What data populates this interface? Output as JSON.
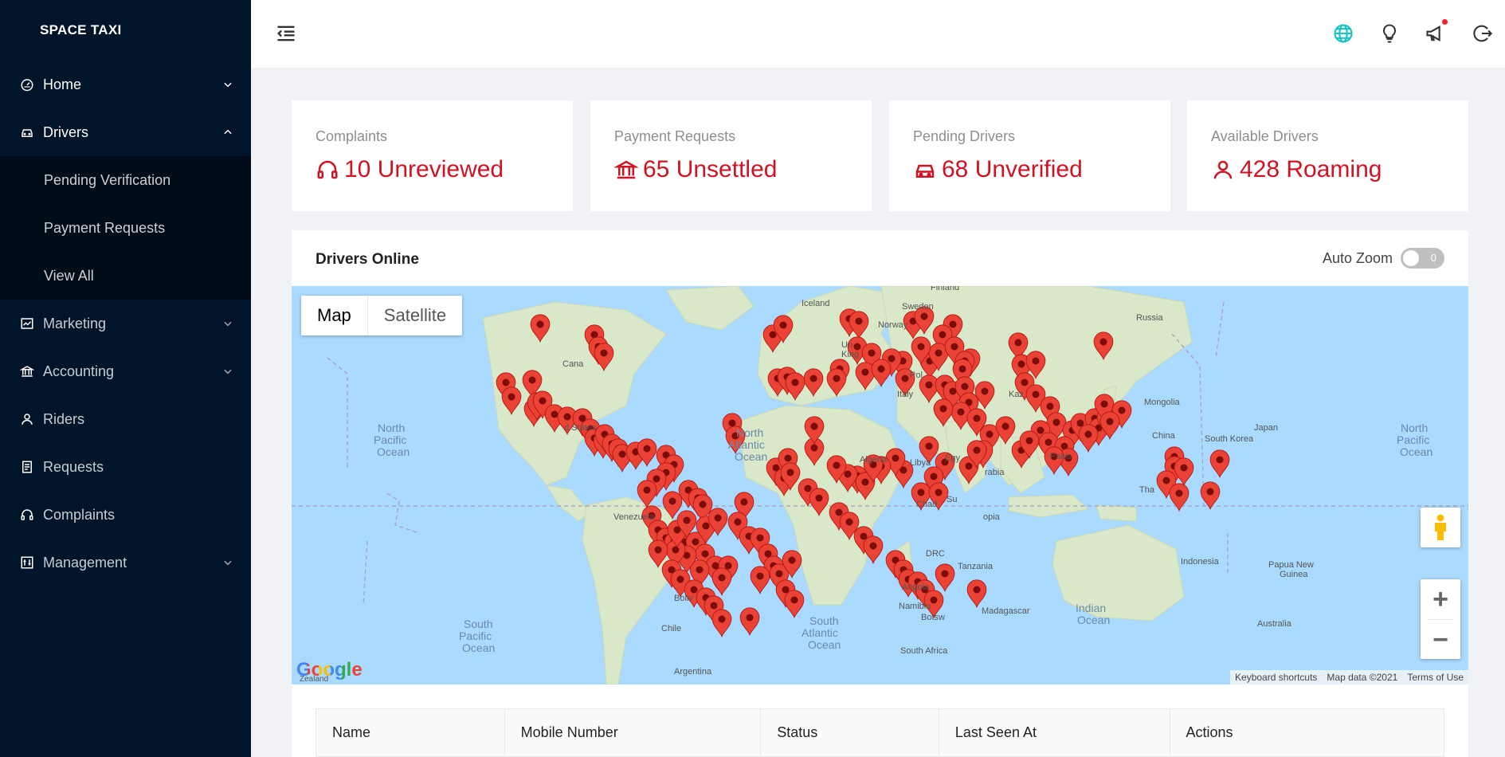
{
  "brand": "SPACE TAXI",
  "sidebar": {
    "items": [
      {
        "label": "Home",
        "icon": "dashboard-icon"
      },
      {
        "label": "Drivers",
        "icon": "car-icon"
      },
      {
        "label": "Marketing",
        "icon": "chart-icon"
      },
      {
        "label": "Accounting",
        "icon": "bank-icon"
      },
      {
        "label": "Riders",
        "icon": "user-icon"
      },
      {
        "label": "Requests",
        "icon": "list-icon"
      },
      {
        "label": "Complaints",
        "icon": "headset-icon"
      },
      {
        "label": "Management",
        "icon": "control-icon"
      }
    ],
    "drivers_submenu": [
      "Pending Verification",
      "Payment Requests",
      "View All"
    ]
  },
  "header": {
    "icons": [
      "globe-icon",
      "bulb-icon",
      "megaphone-icon",
      "logout-icon"
    ],
    "accent": "#13c2c2"
  },
  "cards": [
    {
      "title": "Complaints",
      "value": "10 Unreviewed",
      "icon": "headset-icon"
    },
    {
      "title": "Payment Requests",
      "value": "65 Unsettled",
      "icon": "bank-icon"
    },
    {
      "title": "Pending Drivers",
      "value": "68 Unverified",
      "icon": "car-icon"
    },
    {
      "title": "Available Drivers",
      "value": "428 Roaming",
      "icon": "user-icon"
    }
  ],
  "value_color": "#cf1322",
  "map_panel": {
    "title": "Drivers Online",
    "auto_zoom_label": "Auto Zoom",
    "auto_zoom_value": "0",
    "map_types": [
      "Map",
      "Satellite"
    ],
    "labels": {
      "finland": "Finland",
      "sweden": "Sweden",
      "iceland": "Iceland",
      "norway": "Norway",
      "russia": "Russia",
      "uk": "Un King",
      "poland": "Pol",
      "italy": "Italy",
      "kaz": "Kaz",
      "mongolia": "Mongolia",
      "canada": "Cana",
      "us": "d States",
      "north_pacific_l1": "North",
      "north_pacific_l2": "Pacific",
      "north_pacific_l3": "Ocean",
      "north_atlantic_l1": "North",
      "north_atlantic_l2": "Atlantic",
      "north_atlantic_l3": "Ocean",
      "china": "China",
      "south_korea": "South Korea",
      "japan": "Japan",
      "north_pacific_r1": "North",
      "north_pacific_r2": "Pacific",
      "north_pacific_r3": "Ocean",
      "algeria": "Algeria",
      "libya": "Libya",
      "egypt": "Egy",
      "arabia": "rabia",
      "pakistan": "Pakis",
      "thai": "Tha",
      "venezuela": "Venezuela",
      "chad": "Chad",
      "sudan": "Su",
      "ethiopia": "opia",
      "drc": "DRC",
      "tanzania": "Tanzania",
      "indonesia": "Indonesia",
      "png_l1": "Papua New",
      "png_l2": "Guinea",
      "angola": "Angola",
      "bolivia": "Boliv",
      "namibia": "Namibia",
      "botswana": "Botsw",
      "madagascar": "Madagascar",
      "indian_l1": "Indian",
      "indian_l2": "Ocean",
      "south_pacific_l1": "South",
      "south_pacific_l2": "Pacific",
      "south_pacific_l3": "Ocean",
      "south_atlantic_l1": "South",
      "south_atlantic_l2": "Atlantic",
      "south_atlantic_l3": "Ocean",
      "chile": "Chile",
      "australia": "Australia",
      "south_africa": "South Africa",
      "argentina": "Argentina",
      "zealand": "Zealand"
    },
    "google": "Google",
    "attribution": [
      "Keyboard shortcuts",
      "Map data ©2021",
      "Terms of Use"
    ],
    "marker_color": "#ea4335"
  },
  "table": {
    "columns": [
      "Name",
      "Mobile Number",
      "Status",
      "Last Seen At",
      "Actions"
    ]
  }
}
